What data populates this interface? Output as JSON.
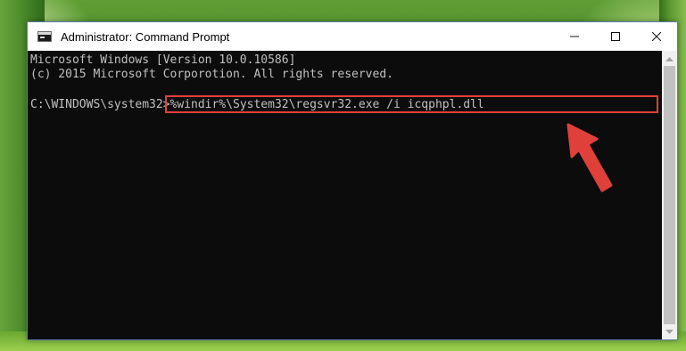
{
  "window": {
    "title": "Administrator: Command Prompt",
    "minimize_label": "—",
    "maximize_label": "☐",
    "close_label": "✕"
  },
  "console": {
    "lines": [
      "Microsoft Windows [Version 10.0.10586]",
      "(c) 2015 Microsoft Corporotion. All rights reserved."
    ],
    "prompt": "C:\\WINDOWS\\system32>",
    "command": "%windir%\\System32\\regsvr32.exe /i icqphpl.dll"
  },
  "annotation": {
    "highlight_color": "#e0403a",
    "arrow_color": "#e0403a",
    "arrow_icon": "pointer-arrow-icon"
  },
  "colors": {
    "console_bg": "#0c0c0c",
    "console_text": "#c0c0c0"
  }
}
